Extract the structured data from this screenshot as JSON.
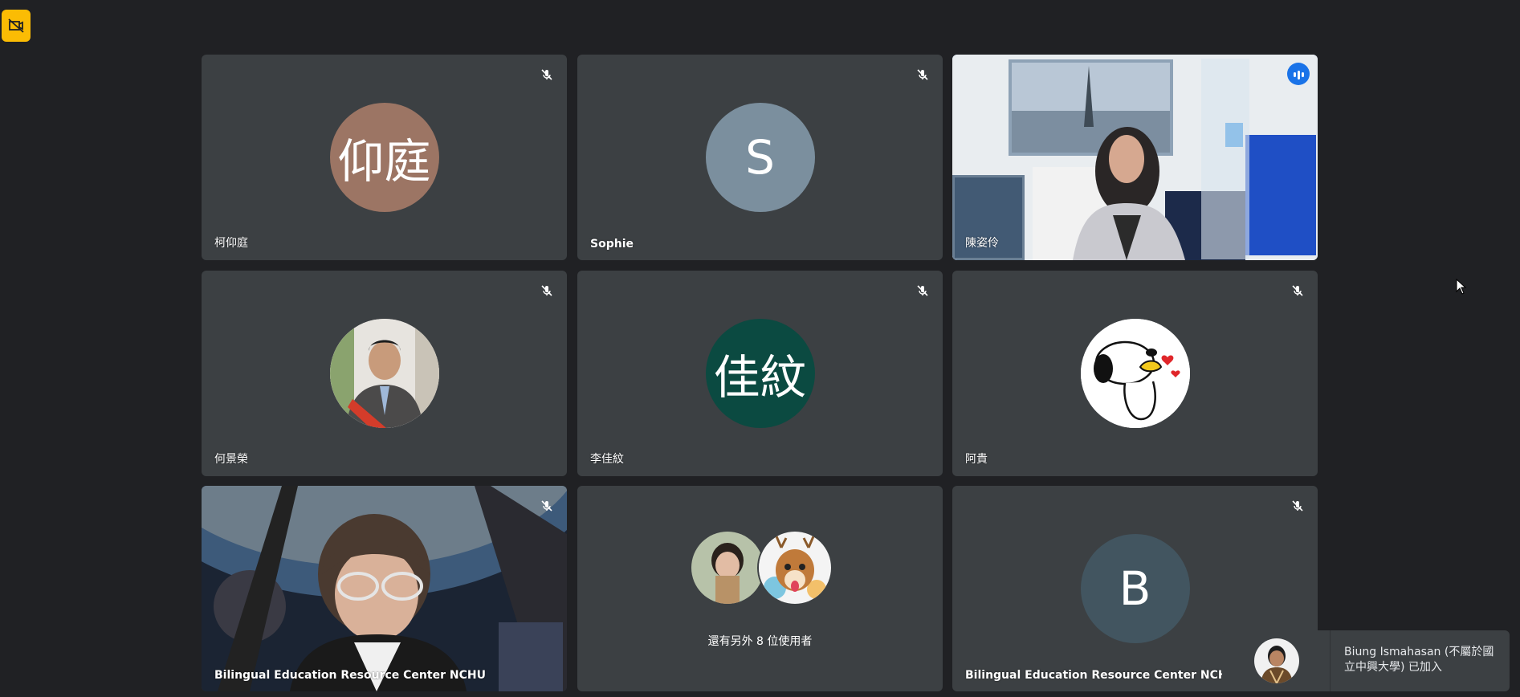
{
  "participants": [
    {
      "name": "柯仰庭",
      "initials": "仰庭",
      "avatar_color": "#9c7564"
    },
    {
      "name": "Sophie",
      "initials": "S",
      "avatar_color": "#7b8f9e"
    },
    {
      "name": "陳姿伶"
    },
    {
      "name": "何景榮"
    },
    {
      "name": "李佳紋",
      "initials": "佳紋",
      "avatar_color": "#0b4a41"
    },
    {
      "name": "阿貴"
    },
    {
      "name": "Bilingual Education Resource Center NCHU"
    },
    {
      "name": "Bilingual Education Resource Center NCHU",
      "initials": "B",
      "avatar_color": "#425560"
    }
  ],
  "others_tile": {
    "label": "還有另外 8 位使用者"
  },
  "toast": {
    "text": "Biung Ismahasan (不屬於國立中興大學) 已加入"
  },
  "colors": {
    "background": "#202124",
    "tile": "#3c4043",
    "active_border": "#8ab4f8",
    "speaking": "#1a73e8",
    "badge": "#fbbc04"
  }
}
